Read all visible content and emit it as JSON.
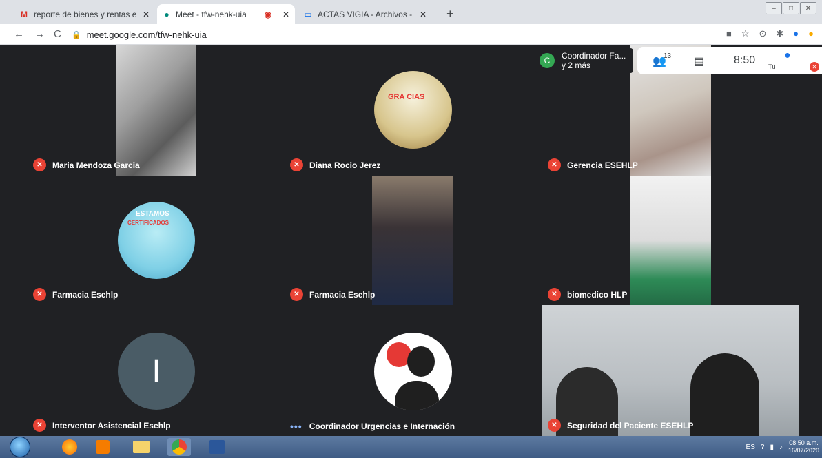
{
  "browser": {
    "tabs": [
      {
        "label": "reporte de bienes y rentas en sig",
        "icon": "gmail-icon"
      },
      {
        "label": "Meet - tfw-nehk-uia",
        "icon": "meet-icon"
      },
      {
        "label": "ACTAS VIGIA - Archivos - LynxClo",
        "icon": "folder-icon"
      }
    ],
    "url": "meet.google.com/tfw-nehk-uia"
  },
  "meet": {
    "chip_initial": "C",
    "chip_line1": "Coordinador Fa...",
    "chip_line2": "y 2 más",
    "participants_count": "13",
    "time": "8:50",
    "self_label": "Tú",
    "tiles": [
      {
        "name": "Maria Mendoza Garcia",
        "muted": true
      },
      {
        "name": "Diana Rocio Jerez",
        "muted": true
      },
      {
        "name": "Gerencia ESEHLP",
        "muted": true
      },
      {
        "name": "Farmacia Esehlp",
        "muted": true
      },
      {
        "name": "Farmacia Esehlp",
        "muted": true
      },
      {
        "name": "biomedico HLP",
        "muted": true
      },
      {
        "name": "Interventor Asistencial Esehlp",
        "muted": true,
        "initial": "I"
      },
      {
        "name": "Coordinador Urgencias e Internación",
        "muted": false
      },
      {
        "name": "Seguridad del Paciente ESEHLP",
        "muted": true
      }
    ],
    "avatar_text_1": "GRA CIAS",
    "avatar_text_2": "ESTAMOS",
    "avatar_text_3": "CERTIFICADOS"
  },
  "taskbar": {
    "lang": "ES",
    "time": "08:50 a.m.",
    "date": "16/07/2020"
  }
}
